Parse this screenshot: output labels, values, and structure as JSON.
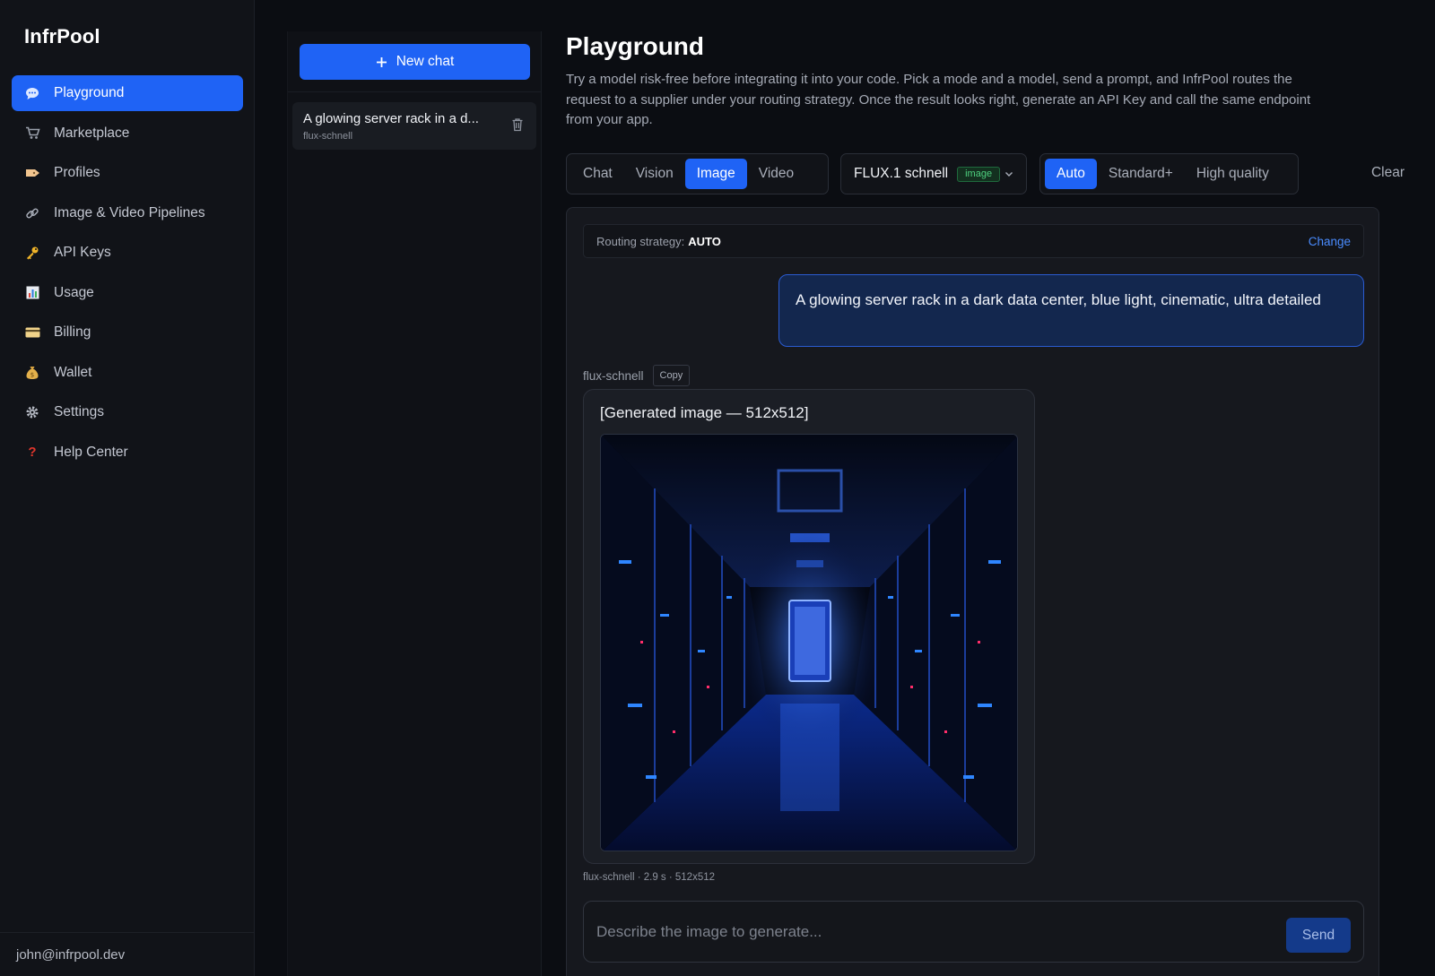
{
  "app": {
    "brand": "InfrPool"
  },
  "colors": {
    "accent": "#1f63f5",
    "badge_green": "#4ed07f",
    "link": "#4a8cff"
  },
  "sidebar": {
    "items": [
      {
        "label": "Playground",
        "icon": "chat-bubble-icon",
        "active": true
      },
      {
        "label": "Marketplace",
        "icon": "cart-icon"
      },
      {
        "label": "Profiles",
        "icon": "tag-icon"
      },
      {
        "label": "Image & Video Pipelines",
        "icon": "link-icon"
      },
      {
        "label": "API Keys",
        "icon": "key-icon"
      },
      {
        "label": "Usage",
        "icon": "bar-chart-icon"
      },
      {
        "label": "Billing",
        "icon": "credit-card-icon"
      },
      {
        "label": "Wallet",
        "icon": "money-bag-icon"
      },
      {
        "label": "Settings",
        "icon": "gear-icon"
      },
      {
        "label": "Help Center",
        "icon": "question-mark-icon"
      }
    ],
    "user_email": "john@infrpool.dev"
  },
  "chatlist": {
    "new_chat_label": "New chat",
    "entries": [
      {
        "title": "A glowing server rack in a d...",
        "model": "flux-schnell"
      }
    ]
  },
  "main": {
    "title": "Playground",
    "description": "Try a model risk-free before integrating it into your code. Pick a mode and a model, send a prompt, and InfrPool routes the request to a supplier under your routing strategy. Once the result looks right, generate an API Key and call the same endpoint from your app.",
    "modes": [
      {
        "label": "Chat"
      },
      {
        "label": "Vision"
      },
      {
        "label": "Image",
        "active": true
      },
      {
        "label": "Video"
      }
    ],
    "model": {
      "name": "FLUX.1 schnell",
      "badge": "image"
    },
    "quality": [
      {
        "label": "Auto",
        "active": true
      },
      {
        "label": "Standard+"
      },
      {
        "label": "High quality"
      }
    ],
    "clear_label": "Clear",
    "routing": {
      "label": "Routing strategy:",
      "value": "AUTO",
      "change_label": "Change"
    },
    "conversation": {
      "user_prompt": "A glowing server rack in a dark data center, blue light, cinematic, ultra detailed",
      "reply_model": "flux-schnell",
      "copy_label": "Copy",
      "reply_caption": "[Generated image — 512x512]",
      "footnote": "flux-schnell · 2.9 s · 512x512"
    },
    "composer": {
      "placeholder": "Describe the image to generate...",
      "send_label": "Send"
    }
  }
}
